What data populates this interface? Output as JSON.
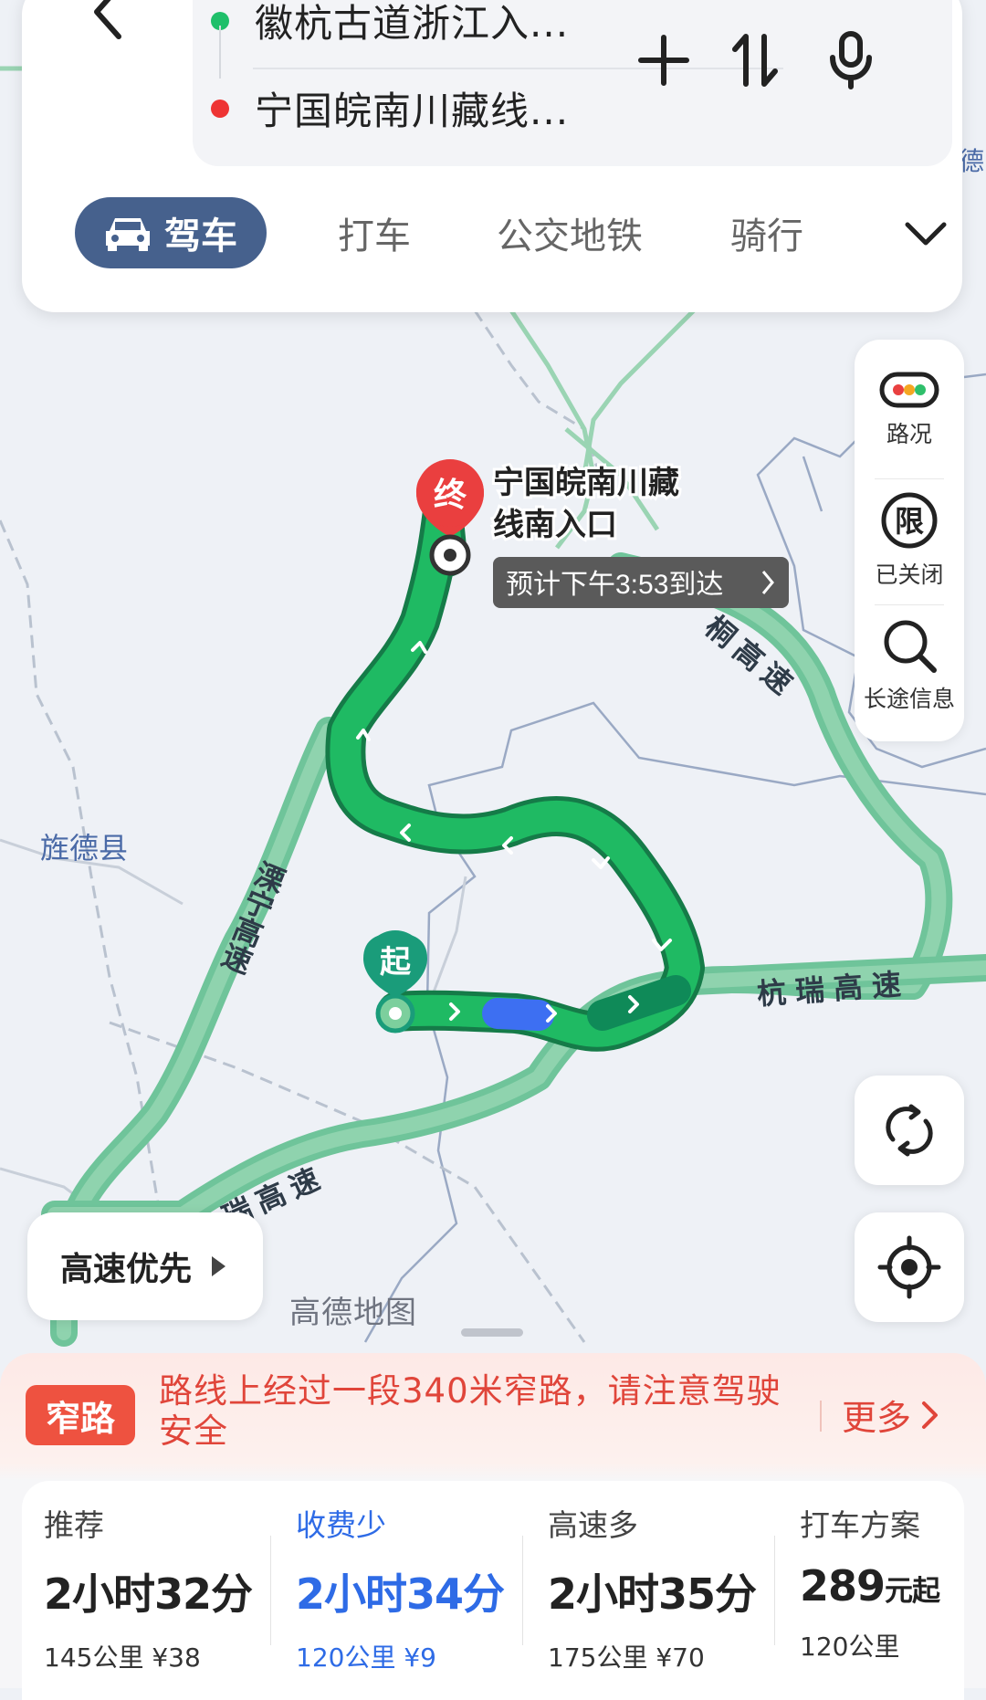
{
  "route_input": {
    "start": "徽杭古道浙江入...",
    "end": "宁国皖南川藏线..."
  },
  "mode_tabs": [
    "驾车",
    "打车",
    "公交地铁",
    "骑行"
  ],
  "map": {
    "labels": {
      "county": "旌德县",
      "hwy_liyang": "溧宁高速",
      "hwy_hangrui_east": "杭瑞高速",
      "hwy_hangrui_west": "瑞高速",
      "hwy_north": "桐高速",
      "edge_fragment": "德"
    },
    "start_marker": "起",
    "end_marker": "终",
    "destination_name": "宁国皖南川藏线南入口",
    "eta_label": "预计下午3:53到达",
    "watermark": "高德地图",
    "colors": {
      "route": "#1fba63",
      "highway": "#6fc49a"
    }
  },
  "side_panel": {
    "traffic": "路况",
    "restriction": "已关闭",
    "long_trip": "长途信息"
  },
  "route_preference": "高速优先",
  "notice": {
    "badge": "窄路",
    "text": "路线上经过一段340米窄路，请注意驾驶安全",
    "more": "更多"
  },
  "route_options": [
    {
      "label": "推荐",
      "time": "2小时32分",
      "meta": "145公里 ¥38",
      "selected": false
    },
    {
      "label": "收费少",
      "time": "2小时34分",
      "meta": "120公里 ¥9",
      "selected": true
    },
    {
      "label": "高速多",
      "time": "2小时35分",
      "meta": "175公里 ¥70",
      "selected": false
    },
    {
      "label": "打车方案",
      "price": "289",
      "price_unit": "元起",
      "meta": "120公里",
      "selected": false
    }
  ],
  "accent_color": "#2e6be6"
}
